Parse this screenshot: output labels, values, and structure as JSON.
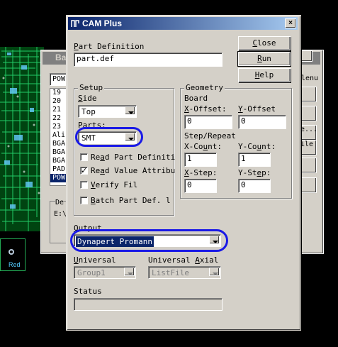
{
  "background_window": {
    "title": "Ba",
    "field_value": "POW",
    "list_items": [
      "19",
      "20",
      "21",
      "22",
      "23",
      "Ali",
      "BGA",
      "BGA",
      "BGA",
      "PAD",
      "POW"
    ],
    "selected_index": 10,
    "group_label": "De",
    "group_value": "E:\\",
    "menu_label": "lenu",
    "button_labels": [
      "",
      "",
      "e...",
      "ile",
      "",
      ""
    ],
    "chip_label": "Red"
  },
  "dialog": {
    "title": "CAM Plus",
    "close_glyph": "×",
    "part_definition": {
      "label_u": "P",
      "label_rest": "art Definition",
      "value": "part.def"
    },
    "buttons": {
      "close": {
        "u": "C",
        "rest": "lose"
      },
      "run": {
        "u": "R",
        "rest": "un"
      },
      "help": {
        "u": "H",
        "rest": "elp"
      }
    },
    "setup": {
      "group_label": "Setup",
      "side_label_pre": "",
      "side_label_u": "S",
      "side_label_post": "ide",
      "side_value": "Top",
      "parts_label_pre": "Pa",
      "parts_label_u": "r",
      "parts_label_post": "ts:",
      "parts_value": "SMT",
      "checkboxes": [
        {
          "pre": "Re",
          "u": "a",
          "post": "d Part Definiti",
          "checked": false,
          "mark": ""
        },
        {
          "pre": "Re",
          "u": "a",
          "post": "d Value Attribu",
          "checked": true,
          "mark": "✓"
        },
        {
          "pre": "",
          "u": "V",
          "post": "erify Fil",
          "checked": false,
          "mark": ""
        },
        {
          "pre": "",
          "u": "B",
          "post": "atch Part Def. l",
          "checked": false,
          "mark": ""
        }
      ]
    },
    "geometry": {
      "group_label": "Geometry",
      "board_label": "Board",
      "x_offset": {
        "u": "X",
        "rest": "-Offset:",
        "value": "0"
      },
      "y_offset": {
        "u": "Y",
        "rest": "-Offset",
        "value": "0"
      },
      "step_repeat_label": "Step/Repeat",
      "x_count": {
        "pre": "X-Co",
        "u": "u",
        "post": "nt:",
        "value": "1"
      },
      "y_count": {
        "pre": "Y-Co",
        "u": "u",
        "post": "nt:",
        "value": "1"
      },
      "x_step": {
        "pre": "",
        "u": "X",
        "post": "-Step:",
        "value": "0"
      },
      "y_step": {
        "pre": "Y-St",
        "u": "e",
        "post": "p:",
        "value": "0"
      }
    },
    "output": {
      "label_u": "O",
      "label_rest": "utput",
      "value": "Dynapert Promann"
    },
    "universal": {
      "label_u": "U",
      "label_rest": "niversal",
      "value": "Group1"
    },
    "universal_axial": {
      "label_pre": "Universal ",
      "label_u": "A",
      "label_post": "xial",
      "value": "ListFile"
    },
    "status": {
      "label": "Status",
      "value": ""
    }
  },
  "colors": {
    "highlight_ellipse": "#1a1ae6",
    "title_gradient_start": "#0a246a",
    "selection": "#0a246a"
  }
}
